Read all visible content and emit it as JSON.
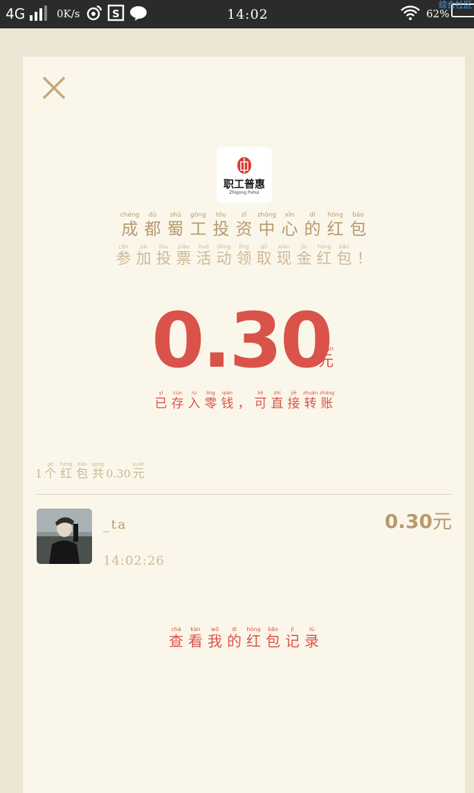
{
  "status_bar": {
    "network": "4G",
    "speed": "0K/s",
    "time": "14:02",
    "battery": "62%",
    "watermark": "综合社区"
  },
  "envelope": {
    "logo_text": "职工普惠",
    "logo_subtext": "Zhigong Puhui",
    "title": [
      {
        "py": "chéng",
        "hz": "成"
      },
      {
        "py": "dū",
        "hz": "都"
      },
      {
        "py": "shǔ",
        "hz": "蜀"
      },
      {
        "py": "gōng",
        "hz": "工"
      },
      {
        "py": "tóu",
        "hz": "投"
      },
      {
        "py": "zī",
        "hz": "资"
      },
      {
        "py": "zhōng",
        "hz": "中"
      },
      {
        "py": "xīn",
        "hz": "心"
      },
      {
        "py": "dí",
        "hz": "的"
      },
      {
        "py": "hóng",
        "hz": "红"
      },
      {
        "py": "bāo",
        "hz": "包"
      }
    ],
    "subtitle": [
      {
        "py": "cān",
        "hz": "参"
      },
      {
        "py": "jiā",
        "hz": "加"
      },
      {
        "py": "tóu",
        "hz": "投"
      },
      {
        "py": "piào",
        "hz": "票"
      },
      {
        "py": "huó",
        "hz": "活"
      },
      {
        "py": "dòng",
        "hz": "动"
      },
      {
        "py": "lǐng",
        "hz": "领"
      },
      {
        "py": "qǔ",
        "hz": "取"
      },
      {
        "py": "xiàn",
        "hz": "现"
      },
      {
        "py": "jīn",
        "hz": "金"
      },
      {
        "py": "hóng",
        "hz": "红"
      },
      {
        "py": "bāo",
        "hz": "包"
      },
      {
        "py": "",
        "hz": "！"
      }
    ],
    "amount": "0.30",
    "unit": {
      "py": "yuán",
      "hz": "元"
    },
    "stored_note": [
      {
        "py": "yǐ",
        "hz": "已"
      },
      {
        "py": "cún",
        "hz": "存"
      },
      {
        "py": "rù",
        "hz": "入"
      },
      {
        "py": "líng",
        "hz": "零"
      },
      {
        "py": "qián",
        "hz": "钱"
      },
      {
        "py": "",
        "hz": "，"
      },
      {
        "py": "kě",
        "hz": "可"
      },
      {
        "py": "zhí",
        "hz": "直"
      },
      {
        "py": "jiē",
        "hz": "接"
      },
      {
        "py": "zhuǎn",
        "hz": "转"
      },
      {
        "py": "zhàng",
        "hz": "账"
      }
    ]
  },
  "summary": {
    "count": "1",
    "chars": [
      {
        "py": "gè",
        "hz": "个"
      },
      {
        "py": "hóng",
        "hz": "红"
      },
      {
        "py": "bāo",
        "hz": "包"
      },
      {
        "py": "gòng",
        "hz": "共"
      }
    ],
    "total": "0.30",
    "unit": {
      "py": "yuán",
      "hz": "元"
    }
  },
  "records": [
    {
      "nickname": "_ta",
      "time": "14:02:26",
      "amount": "0.30",
      "unit": "元"
    }
  ],
  "history_link": [
    {
      "py": "chá",
      "hz": "查"
    },
    {
      "py": "kàn",
      "hz": "看"
    },
    {
      "py": "wǒ",
      "hz": "我"
    },
    {
      "py": "dí",
      "hz": "的"
    },
    {
      "py": "hóng",
      "hz": "红"
    },
    {
      "py": "bāo",
      "hz": "包"
    },
    {
      "py": "jì",
      "hz": "记"
    },
    {
      "py": "lù",
      "hz": "录"
    }
  ],
  "colors": {
    "accent_red": "#d9534a",
    "gold": "#b79a6d",
    "card_bg": "#fbf6ea",
    "page_bg": "#ede5d4"
  }
}
